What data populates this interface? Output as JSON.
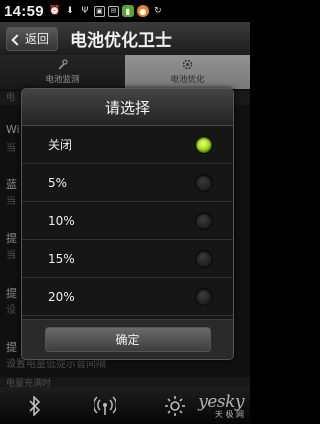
{
  "status_bar": {
    "time": "14:59",
    "icons": [
      "alarm-icon",
      "download-icon",
      "usb-icon",
      "nfc-icon",
      "chat-icon",
      "battery-icon",
      "browser-icon",
      "sync-icon"
    ]
  },
  "header": {
    "back_label": "返回",
    "title": "电池优化卫士"
  },
  "tabs": [
    {
      "label": "电池监测",
      "active": false
    },
    {
      "label": "电池优化",
      "active": true
    }
  ],
  "background": {
    "section_top": "电",
    "rows": [
      {
        "label": "Wi",
        "sub": "当"
      },
      {
        "label": "蓝",
        "sub": "当"
      },
      {
        "label": "提",
        "sub": "当"
      },
      {
        "label": "提",
        "sub": "设"
      },
      {
        "label": "提",
        "sub": "设置电量低提示音间隔"
      }
    ],
    "section_bottom": "电量充满时"
  },
  "dialog": {
    "title": "请选择",
    "options": [
      {
        "label": "关闭",
        "checked": true
      },
      {
        "label": "5%",
        "checked": false
      },
      {
        "label": "10%",
        "checked": false
      },
      {
        "label": "15%",
        "checked": false
      },
      {
        "label": "20%",
        "checked": false
      }
    ],
    "confirm_label": "确定"
  },
  "bottom_bar": {
    "icons": [
      "bluetooth-icon",
      "wifi-hotspot-icon",
      "brightness-icon"
    ]
  },
  "watermark": {
    "brand": "yesky",
    "sub": "天 极 网"
  },
  "colors": {
    "accent_green": "#a8de1c",
    "tab_active_bg": "#cfcfcf"
  }
}
